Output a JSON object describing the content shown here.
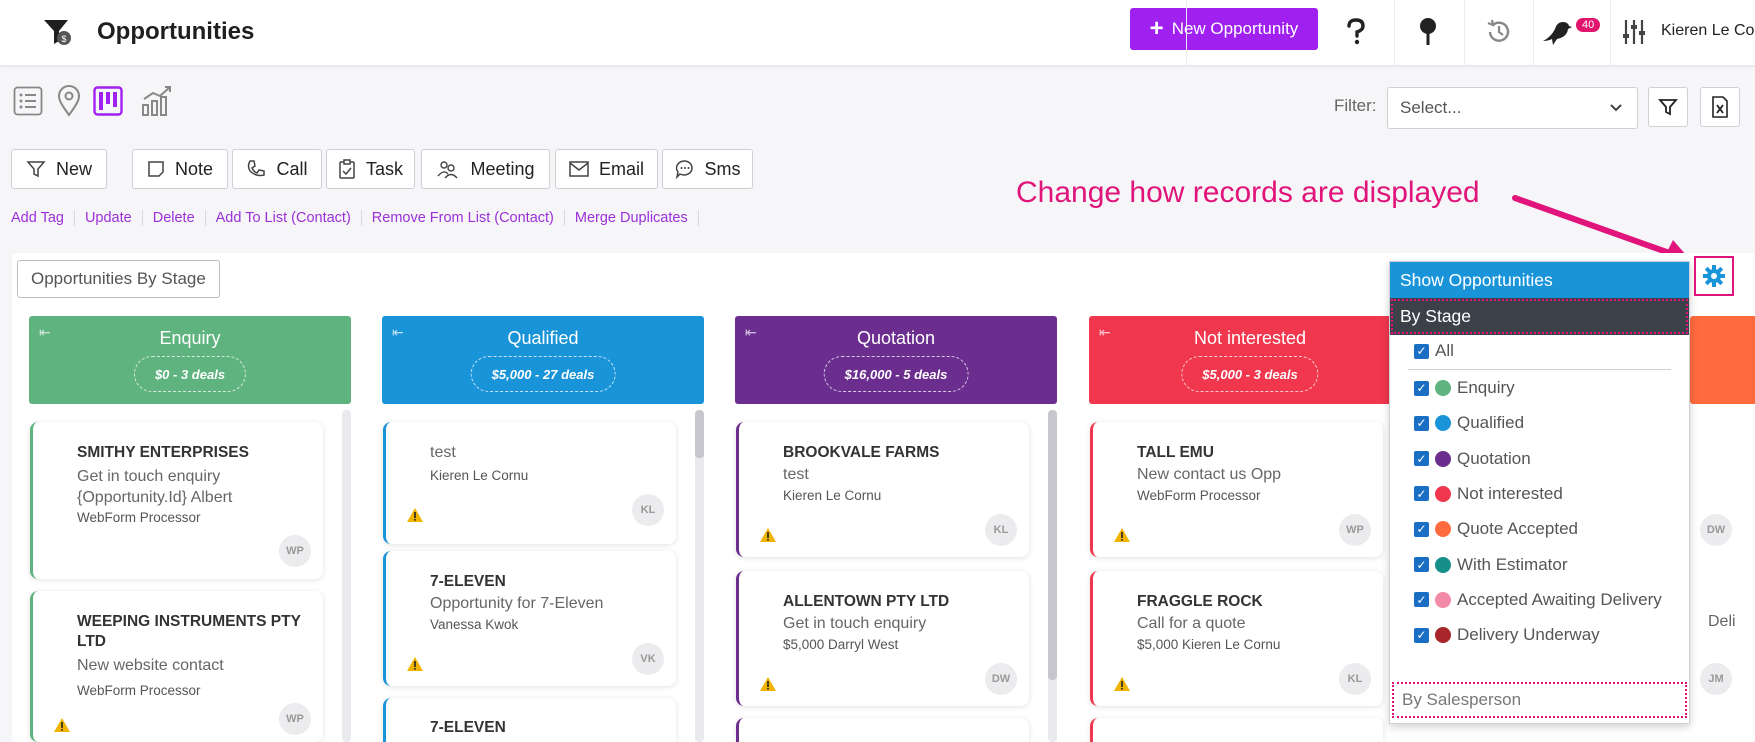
{
  "header": {
    "title": "Opportunities",
    "new_button": "New Opportunity",
    "notifications_count": "40",
    "user_name": "Kieren Le Cornu",
    "accent": "#a020f0"
  },
  "toolbar": {
    "filter_label": "Filter:",
    "filter_placeholder": "Select...",
    "actions": [
      "New",
      "Note",
      "Call",
      "Task",
      "Meeting",
      "Email",
      "Sms"
    ],
    "links": [
      "Add Tag",
      "Update",
      "Delete",
      "Add To List (Contact)",
      "Remove From List (Contact)",
      "Merge Duplicates"
    ]
  },
  "annotation": "Change how records are displayed",
  "board": {
    "title": "Opportunities By Stage",
    "columns": [
      {
        "name": "Enquiry",
        "summary": "$0 - 3 deals",
        "color": "#5fb37e",
        "cards": [
          {
            "title": "SMITHY ENTERPRISES",
            "sub": "Get in touch enquiry {Opportunity.Id} Albert",
            "owner": "WebForm Processor",
            "initials": "WP"
          },
          {
            "title": "WEEPING INSTRUMENTS PTY LTD",
            "sub": "New website contact",
            "owner": "WebForm Processor",
            "initials": "WP"
          }
        ]
      },
      {
        "name": "Qualified",
        "summary": "$5,000 - 27 deals",
        "color": "#1a94d8",
        "cards": [
          {
            "title": "",
            "sub": "test",
            "owner": "Kieren Le Cornu",
            "initials": "KL"
          },
          {
            "title": "7-ELEVEN",
            "sub": "Opportunity for 7-Eleven",
            "owner": "Vanessa Kwok",
            "initials": "VK"
          },
          {
            "title": "7-ELEVEN",
            "sub": "",
            "owner": "",
            "initials": ""
          }
        ]
      },
      {
        "name": "Quotation",
        "summary": "$16,000 - 5 deals",
        "color": "#6b2e8f",
        "cards": [
          {
            "title": "BROOKVALE FARMS",
            "sub": "test",
            "owner": "Kieren Le Cornu",
            "initials": "KL"
          },
          {
            "title": "ALLENTOWN PTY LTD",
            "sub": "Get in touch enquiry",
            "owner": "$5,000   Darryl West",
            "initials": "DW"
          }
        ]
      },
      {
        "name": "Not interested",
        "summary": "$5,000 - 3 deals",
        "color": "#f0374e",
        "cards": [
          {
            "title": "TALL EMU",
            "sub": "New contact us Opp",
            "owner": "WebForm Processor",
            "initials": "WP"
          },
          {
            "title": "FRAGGLE ROCK",
            "sub": "Call for a quote",
            "owner": "$5,000   Kieren Le Cornu",
            "initials": "KL"
          }
        ]
      }
    ],
    "partial_right": {
      "initials_1": "DW",
      "text": "Deli",
      "initials_2": "JM"
    }
  },
  "dropdown": {
    "header": "Show Opportunities",
    "by_stage": "By Stage",
    "all_label": "All",
    "stages": [
      {
        "label": "Enquiry",
        "color": "#5fb37e"
      },
      {
        "label": "Qualified",
        "color": "#1a94d8"
      },
      {
        "label": "Quotation",
        "color": "#6b2e8f"
      },
      {
        "label": "Not interested",
        "color": "#f0374e"
      },
      {
        "label": "Quote Accepted",
        "color": "#ff6b3d"
      },
      {
        "label": "With Estimator",
        "color": "#168f8a"
      },
      {
        "label": "Accepted Awaiting Delivery",
        "color": "#f28aa8"
      },
      {
        "label": "Delivery Underway",
        "color": "#a8272a"
      }
    ],
    "by_salesperson": "By Salesperson"
  }
}
